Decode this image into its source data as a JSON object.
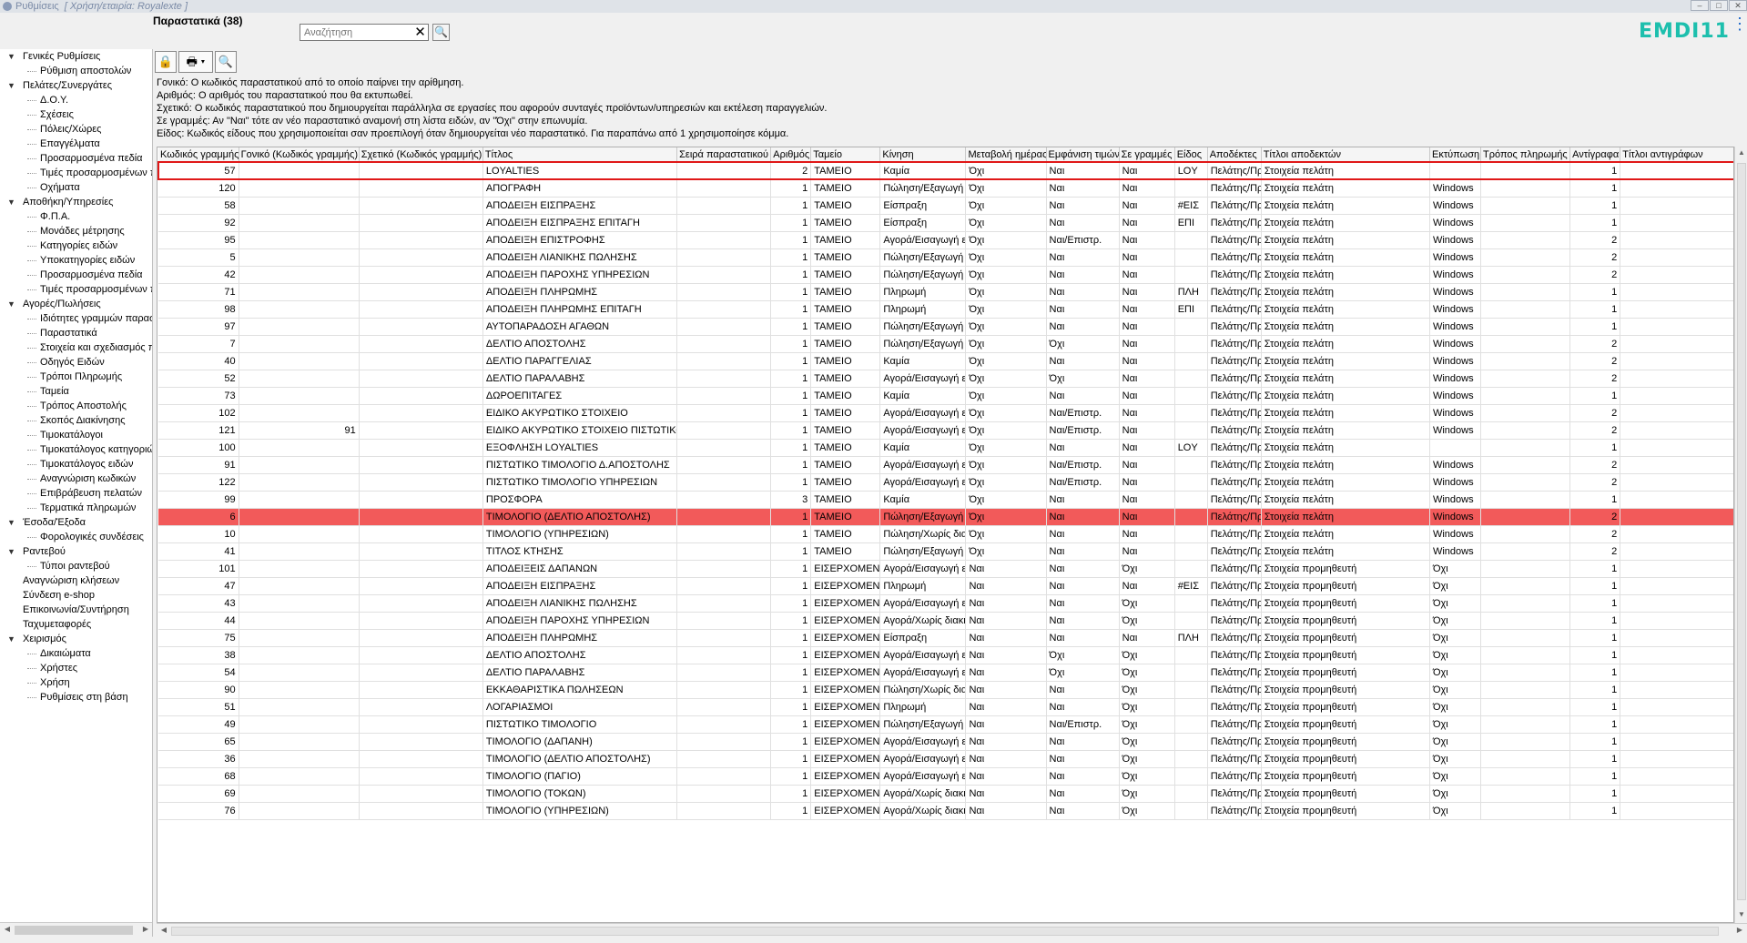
{
  "window": {
    "title": "Ρυθμίσεις",
    "company": "[ Χρήση/εταιρία: Royalexte ]",
    "controls": [
      "–",
      "□",
      "✕"
    ]
  },
  "header": {
    "section_title": "Παραστατικά (38)",
    "search_placeholder": "Αναζήτηση",
    "search_clear_icon": "✕",
    "search_button_icon": "🔍",
    "logo": "EMDI11",
    "menu_icon": "⋮"
  },
  "toolbar": {
    "lock_icon": "🔒",
    "print_icon": "🖶",
    "print_dropdown_icon": "▾",
    "search_icon": "🔍"
  },
  "tree": [
    {
      "label": "Γενικές Ρυθμίσεις",
      "level": 0,
      "toggle": "▼"
    },
    {
      "label": "Ρύθμιση αποστολών",
      "level": 1
    },
    {
      "label": "Πελάτες/Συνεργάτες",
      "level": 0,
      "toggle": "▼"
    },
    {
      "label": "Δ.Ο.Υ.",
      "level": 1
    },
    {
      "label": "Σχέσεις",
      "level": 1
    },
    {
      "label": "Πόλεις/Χώρες",
      "level": 1
    },
    {
      "label": "Επαγγέλματα",
      "level": 1
    },
    {
      "label": "Προσαρμοσμένα πεδία",
      "level": 1
    },
    {
      "label": "Τιμές προσαρμοσμένων π",
      "level": 1
    },
    {
      "label": "Οχήματα",
      "level": 1
    },
    {
      "label": "Αποθήκη/Υπηρεσίες",
      "level": 0,
      "toggle": "▼"
    },
    {
      "label": "Φ.Π.Α.",
      "level": 1
    },
    {
      "label": "Μονάδες μέτρησης",
      "level": 1
    },
    {
      "label": "Κατηγορίες ειδών",
      "level": 1
    },
    {
      "label": "Υποκατηγορίες ειδών",
      "level": 1
    },
    {
      "label": "Προσαρμοσμένα πεδία",
      "level": 1
    },
    {
      "label": "Τιμές προσαρμοσμένων π",
      "level": 1
    },
    {
      "label": "Αγορές/Πωλήσεις",
      "level": 0,
      "toggle": "▼"
    },
    {
      "label": "Ιδιότητες γραμμών παρασ",
      "level": 1
    },
    {
      "label": "Παραστατικά",
      "level": 1
    },
    {
      "label": "Στοιχεία και σχεδιασμός π",
      "level": 1
    },
    {
      "label": "Οδηγός Ειδών",
      "level": 1
    },
    {
      "label": "Τρόποι Πληρωμής",
      "level": 1
    },
    {
      "label": "Ταμεία",
      "level": 1
    },
    {
      "label": "Τρόπος Αποστολής",
      "level": 1
    },
    {
      "label": "Σκοπός Διακίνησης",
      "level": 1
    },
    {
      "label": "Τιμοκατάλογοι",
      "level": 1
    },
    {
      "label": "Τιμοκατάλογος κατηγοριώ",
      "level": 1
    },
    {
      "label": "Τιμοκατάλογος ειδών",
      "level": 1
    },
    {
      "label": "Αναγνώριση κωδικών",
      "level": 1
    },
    {
      "label": "Επιβράβευση πελατών",
      "level": 1
    },
    {
      "label": "Τερματικά πληρωμών",
      "level": 1
    },
    {
      "label": "Έσοδα/Έξοδα",
      "level": 0,
      "toggle": "▼"
    },
    {
      "label": "Φορολογικές συνδέσεις",
      "level": 1
    },
    {
      "label": "Ραντεβού",
      "level": 0,
      "toggle": "▼"
    },
    {
      "label": "Τύποι ραντεβού",
      "level": 1
    },
    {
      "label": "Αναγνώριση κλήσεων",
      "level": 0
    },
    {
      "label": "Σύνδεση e-shop",
      "level": 0
    },
    {
      "label": "Επικοινωνία/Συντήρηση",
      "level": 0
    },
    {
      "label": "Ταχυμεταφορές",
      "level": 0
    },
    {
      "label": "Χειρισμός",
      "level": 0,
      "toggle": "▼"
    },
    {
      "label": "Δικαιώματα",
      "level": 1
    },
    {
      "label": "Χρήστες",
      "level": 1
    },
    {
      "label": "Χρήση",
      "level": 1
    },
    {
      "label": "Ρυθμίσεις στη βάση",
      "level": 1
    }
  ],
  "help_lines": [
    "Γονικό: Ο κωδικός παραστατικού από το οποίο παίρνει την αρίθμηση.",
    "Αριθμός: Ο αριθμός του παραστατικού που θα εκτυπωθεί.",
    "Σχετικό: Ο κωδικός παραστατικού που δημιουργείται παράλληλα σε εργασίες που αφορούν συνταγές προϊόντων/υπηρεσιών και εκτέλεση παραγγελιών.",
    "Σε γραμμές: Αν \"Ναι\" τότε αν νέο παραστατικό αναμονή στη λίστα ειδών, αν \"Όχι\" στην επωνυμία.",
    "Είδος: Κωδικός είδους που χρησιμοποιείται σαν προεπιλογή όταν δημιουργείται νέο παραστατικό. Για παραπάνω από 1 χρησιμοποίησε κόμμα."
  ],
  "grid": {
    "columns": [
      "Κωδικός γραμμής",
      "Γονικό (Κωδικός γραμμής)",
      "Σχετικό (Κωδικός γραμμής)",
      "Τίτλος",
      "Σειρά παραστατικού",
      "Αριθμός",
      "Ταμείο",
      "Κίνηση",
      "Μεταβολή ημέρας",
      "Εμφάνιση τιμών",
      "Σε γραμμές",
      "Είδος",
      "Αποδέκτες",
      "Τίτλοι αποδεκτών",
      "Εκτύπωση",
      "Τρόπος πληρωμής",
      "Αντίγραφα",
      "Τίτλοι αντιγράφων"
    ],
    "rows": [
      [
        "57",
        "",
        "",
        "LOYALTIES",
        "",
        "2",
        "ΤΑΜΕΙΟ",
        "Καμία",
        "Όχι",
        "Ναι",
        "Ναι",
        "LOY",
        "Πελάτης/Πρ",
        "Στοιχεία πελάτη",
        "",
        "",
        "1",
        ""
      ],
      [
        "120",
        "",
        "",
        "ΑΠΟΓΡΑΦΗ",
        "",
        "1",
        "ΤΑΜΕΙΟ",
        "Πώληση/Εξαγωγή ε",
        "Όχι",
        "Ναι",
        "Ναι",
        "",
        "Πελάτης/Πρ",
        "Στοιχεία πελάτη",
        "Windows",
        "",
        "1",
        ""
      ],
      [
        "58",
        "",
        "",
        "ΑΠΟΔΕΙΞΗ ΕΙΣΠΡΑΞΗΣ",
        "",
        "1",
        "ΤΑΜΕΙΟ",
        "Είσπραξη",
        "Όχι",
        "Ναι",
        "Ναι",
        "#ΕΙΣ",
        "Πελάτης/Πρ",
        "Στοιχεία πελάτη",
        "Windows",
        "",
        "1",
        ""
      ],
      [
        "92",
        "",
        "",
        "ΑΠΟΔΕΙΞΗ ΕΙΣΠΡΑΞΗΣ ΕΠΙΤΑΓΗ",
        "",
        "1",
        "ΤΑΜΕΙΟ",
        "Είσπραξη",
        "Όχι",
        "Ναι",
        "Ναι",
        "ΕΠΙ",
        "Πελάτης/Πρ",
        "Στοιχεία πελάτη",
        "Windows",
        "",
        "1",
        ""
      ],
      [
        "95",
        "",
        "",
        "ΑΠΟΔΕΙΞΗ ΕΠΙΣΤΡΟΦΗΣ",
        "",
        "1",
        "ΤΑΜΕΙΟ",
        "Αγορά/Εισαγωγή ε",
        "Όχι",
        "Ναι/Επιστρ.",
        "Ναι",
        "",
        "Πελάτης/Πρ",
        "Στοιχεία πελάτη",
        "Windows",
        "",
        "2",
        ""
      ],
      [
        "5",
        "",
        "",
        "ΑΠΟΔΕΙΞΗ ΛΙΑΝΙΚΗΣ ΠΩΛΗΣΗΣ",
        "",
        "1",
        "ΤΑΜΕΙΟ",
        "Πώληση/Εξαγωγή ε",
        "Όχι",
        "Ναι",
        "Ναι",
        "",
        "Πελάτης/Πρ",
        "Στοιχεία πελάτη",
        "Windows",
        "",
        "2",
        ""
      ],
      [
        "42",
        "",
        "",
        "ΑΠΟΔΕΙΞΗ ΠΑΡΟΧΗΣ ΥΠΗΡΕΣΙΩΝ",
        "",
        "1",
        "ΤΑΜΕΙΟ",
        "Πώληση/Εξαγωγή ε",
        "Όχι",
        "Ναι",
        "Ναι",
        "",
        "Πελάτης/Πρ",
        "Στοιχεία πελάτη",
        "Windows",
        "",
        "2",
        ""
      ],
      [
        "71",
        "",
        "",
        "ΑΠΟΔΕΙΞΗ ΠΛΗΡΩΜΗΣ",
        "",
        "1",
        "ΤΑΜΕΙΟ",
        "Πληρωμή",
        "Όχι",
        "Ναι",
        "Ναι",
        "ΠΛΗ",
        "Πελάτης/Πρ",
        "Στοιχεία πελάτη",
        "Windows",
        "",
        "1",
        ""
      ],
      [
        "98",
        "",
        "",
        "ΑΠΟΔΕΙΞΗ ΠΛΗΡΩΜΗΣ ΕΠΙΤΑΓΗ",
        "",
        "1",
        "ΤΑΜΕΙΟ",
        "Πληρωμή",
        "Όχι",
        "Ναι",
        "Ναι",
        "ΕΠΙ",
        "Πελάτης/Πρ",
        "Στοιχεία πελάτη",
        "Windows",
        "",
        "1",
        ""
      ],
      [
        "97",
        "",
        "",
        "ΑΥΤΟΠΑΡΑΔΟΣΗ ΑΓΑΘΩΝ",
        "",
        "1",
        "ΤΑΜΕΙΟ",
        "Πώληση/Εξαγωγή ε",
        "Όχι",
        "Ναι",
        "Ναι",
        "",
        "Πελάτης/Πρ",
        "Στοιχεία πελάτη",
        "Windows",
        "",
        "1",
        ""
      ],
      [
        "7",
        "",
        "",
        "ΔΕΛΤΙΟ ΑΠΟΣΤΟΛΗΣ",
        "",
        "1",
        "ΤΑΜΕΙΟ",
        "Πώληση/Εξαγωγή ε",
        "Όχι",
        "Όχι",
        "Ναι",
        "",
        "Πελάτης/Πρ",
        "Στοιχεία πελάτη",
        "Windows",
        "",
        "2",
        ""
      ],
      [
        "40",
        "",
        "",
        "ΔΕΛΤΙΟ ΠΑΡΑΓΓΕΛΙΑΣ",
        "",
        "1",
        "ΤΑΜΕΙΟ",
        "Καμία",
        "Όχι",
        "Ναι",
        "Ναι",
        "",
        "Πελάτης/Πρ",
        "Στοιχεία πελάτη",
        "Windows",
        "",
        "2",
        ""
      ],
      [
        "52",
        "",
        "",
        "ΔΕΛΤΙΟ ΠΑΡΑΛΑΒΗΣ",
        "",
        "1",
        "ΤΑΜΕΙΟ",
        "Αγορά/Εισαγωγή ε",
        "Όχι",
        "Όχι",
        "Ναι",
        "",
        "Πελάτης/Πρ",
        "Στοιχεία πελάτη",
        "Windows",
        "",
        "2",
        ""
      ],
      [
        "73",
        "",
        "",
        "ΔΩΡΟΕΠΙΤΑΓΕΣ",
        "",
        "1",
        "ΤΑΜΕΙΟ",
        "Καμία",
        "Όχι",
        "Ναι",
        "Ναι",
        "",
        "Πελάτης/Πρ",
        "Στοιχεία πελάτη",
        "Windows",
        "",
        "1",
        ""
      ],
      [
        "102",
        "",
        "",
        "ΕΙΔΙΚΟ ΑΚΥΡΩΤΙΚΟ ΣΤΟΙΧΕΙΟ",
        "",
        "1",
        "ΤΑΜΕΙΟ",
        "Αγορά/Εισαγωγή ε",
        "Όχι",
        "Ναι/Επιστρ.",
        "Ναι",
        "",
        "Πελάτης/Πρ",
        "Στοιχεία πελάτη",
        "Windows",
        "",
        "2",
        ""
      ],
      [
        "121",
        "91",
        "",
        "ΕΙΔΙΚΟ ΑΚΥΡΩΤΙΚΟ ΣΤΟΙΧΕΙΟ ΠΙΣΤΩΤΙΚΟ",
        "",
        "1",
        "ΤΑΜΕΙΟ",
        "Αγορά/Εισαγωγή ε",
        "Όχι",
        "Ναι/Επιστρ.",
        "Ναι",
        "",
        "Πελάτης/Πρ",
        "Στοιχεία πελάτη",
        "Windows",
        "",
        "2",
        ""
      ],
      [
        "100",
        "",
        "",
        "ΕΞΟΦΛΗΣΗ LOYALTIES",
        "",
        "1",
        "ΤΑΜΕΙΟ",
        "Καμία",
        "Όχι",
        "Ναι",
        "Ναι",
        "LOY",
        "Πελάτης/Πρ",
        "Στοιχεία πελάτη",
        "",
        "",
        "1",
        ""
      ],
      [
        "91",
        "",
        "",
        "ΠΙΣΤΩΤΙΚΟ ΤΙΜΟΛΟΓΙΟ Δ.ΑΠΟΣΤΟΛΗΣ",
        "",
        "1",
        "ΤΑΜΕΙΟ",
        "Αγορά/Εισαγωγή ε",
        "Όχι",
        "Ναι/Επιστρ.",
        "Ναι",
        "",
        "Πελάτης/Πρ",
        "Στοιχεία πελάτη",
        "Windows",
        "",
        "2",
        ""
      ],
      [
        "122",
        "",
        "",
        "ΠΙΣΤΩΤΙΚΟ ΤΙΜΟΛΟΓΙΟ ΥΠΗΡΕΣΙΩΝ",
        "",
        "1",
        "ΤΑΜΕΙΟ",
        "Αγορά/Εισαγωγή ε",
        "Όχι",
        "Ναι/Επιστρ.",
        "Ναι",
        "",
        "Πελάτης/Πρ",
        "Στοιχεία πελάτη",
        "Windows",
        "",
        "2",
        ""
      ],
      [
        "99",
        "",
        "",
        "ΠΡΟΣΦΟΡΑ",
        "",
        "3",
        "ΤΑΜΕΙΟ",
        "Καμία",
        "Όχι",
        "Ναι",
        "Ναι",
        "",
        "Πελάτης/Πρ",
        "Στοιχεία πελάτη",
        "Windows",
        "",
        "1",
        ""
      ],
      [
        "6",
        "",
        "",
        "ΤΙΜΟΛΟΓΙΟ (ΔΕΛΤΙΟ ΑΠΟΣΤΟΛΗΣ)",
        "",
        "1",
        "ΤΑΜΕΙΟ",
        "Πώληση/Εξαγωγή ε",
        "Όχι",
        "Ναι",
        "Ναι",
        "",
        "Πελάτης/Πρ",
        "Στοιχεία πελάτη",
        "Windows",
        "",
        "2",
        ""
      ],
      [
        "10",
        "",
        "",
        "ΤΙΜΟΛΟΓΙΟ (ΥΠΗΡΕΣΙΩΝ)",
        "",
        "1",
        "ΤΑΜΕΙΟ",
        "Πώληση/Χωρίς διακ",
        "Όχι",
        "Ναι",
        "Ναι",
        "",
        "Πελάτης/Πρ",
        "Στοιχεία πελάτη",
        "Windows",
        "",
        "2",
        ""
      ],
      [
        "41",
        "",
        "",
        "ΤΙΤΛΟΣ ΚΤΗΣΗΣ",
        "",
        "1",
        "ΤΑΜΕΙΟ",
        "Πώληση/Εξαγωγή ε",
        "Όχι",
        "Ναι",
        "Ναι",
        "",
        "Πελάτης/Πρ",
        "Στοιχεία πελάτη",
        "Windows",
        "",
        "2",
        ""
      ],
      [
        "101",
        "",
        "",
        "ΑΠΟΔΕΙΞΕΙΣ ΔΑΠΑΝΩΝ",
        "",
        "1",
        "ΕΙΣΕΡΧΟΜΕΝΑ",
        "Αγορά/Εισαγωγή ε",
        "Ναι",
        "Ναι",
        "Όχι",
        "",
        "Πελάτης/Πρ",
        "Στοιχεία προμηθευτή",
        "Όχι",
        "",
        "1",
        ""
      ],
      [
        "47",
        "",
        "",
        "ΑΠΟΔΕΙΞΗ ΕΙΣΠΡΑΞΗΣ",
        "",
        "1",
        "ΕΙΣΕΡΧΟΜΕΝΑ",
        "Πληρωμή",
        "Ναι",
        "Ναι",
        "Ναι",
        "#ΕΙΣ",
        "Πελάτης/Πρ",
        "Στοιχεία προμηθευτή",
        "Όχι",
        "",
        "1",
        ""
      ],
      [
        "43",
        "",
        "",
        "ΑΠΟΔΕΙΞΗ ΛΙΑΝΙΚΗΣ ΠΩΛΗΣΗΣ",
        "",
        "1",
        "ΕΙΣΕΡΧΟΜΕΝΑ",
        "Αγορά/Εισαγωγή ε",
        "Ναι",
        "Ναι",
        "Όχι",
        "",
        "Πελάτης/Πρ",
        "Στοιχεία προμηθευτή",
        "Όχι",
        "",
        "1",
        ""
      ],
      [
        "44",
        "",
        "",
        "ΑΠΟΔΕΙΞΗ ΠΑΡΟΧΗΣ ΥΠΗΡΕΣΙΩΝ",
        "",
        "1",
        "ΕΙΣΕΡΧΟΜΕΝΑ",
        "Αγορά/Χωρίς διακι",
        "Ναι",
        "Ναι",
        "Όχι",
        "",
        "Πελάτης/Πρ",
        "Στοιχεία προμηθευτή",
        "Όχι",
        "",
        "1",
        ""
      ],
      [
        "75",
        "",
        "",
        "ΑΠΟΔΕΙΞΗ ΠΛΗΡΩΜΗΣ",
        "",
        "1",
        "ΕΙΣΕΡΧΟΜΕΝΑ",
        "Είσπραξη",
        "Ναι",
        "Ναι",
        "Ναι",
        "ΠΛΗ",
        "Πελάτης/Πρ",
        "Στοιχεία προμηθευτή",
        "Όχι",
        "",
        "1",
        ""
      ],
      [
        "38",
        "",
        "",
        "ΔΕΛΤΙΟ ΑΠΟΣΤΟΛΗΣ",
        "",
        "1",
        "ΕΙΣΕΡΧΟΜΕΝΑ",
        "Αγορά/Εισαγωγή ε",
        "Ναι",
        "Όχι",
        "Όχι",
        "",
        "Πελάτης/Πρ",
        "Στοιχεία προμηθευτή",
        "Όχι",
        "",
        "1",
        ""
      ],
      [
        "54",
        "",
        "",
        "ΔΕΛΤΙΟ ΠΑΡΑΛΑΒΗΣ",
        "",
        "1",
        "ΕΙΣΕΡΧΟΜΕΝΑ",
        "Αγορά/Εισαγωγή ε",
        "Ναι",
        "Όχι",
        "Όχι",
        "",
        "Πελάτης/Πρ",
        "Στοιχεία προμηθευτή",
        "Όχι",
        "",
        "1",
        ""
      ],
      [
        "90",
        "",
        "",
        "ΕΚΚΑΘΑΡΙΣΤΙΚΑ ΠΩΛΗΣΕΩΝ",
        "",
        "1",
        "ΕΙΣΕΡΧΟΜΕΝΑ",
        "Πώληση/Χωρίς διακ",
        "Ναι",
        "Ναι",
        "Όχι",
        "",
        "Πελάτης/Πρ",
        "Στοιχεία προμηθευτή",
        "Όχι",
        "",
        "1",
        ""
      ],
      [
        "51",
        "",
        "",
        "ΛΟΓΑΡΙΑΣΜΟΙ",
        "",
        "1",
        "ΕΙΣΕΡΧΟΜΕΝΑ",
        "Πληρωμή",
        "Ναι",
        "Ναι",
        "Όχι",
        "",
        "Πελάτης/Πρ",
        "Στοιχεία προμηθευτή",
        "Όχι",
        "",
        "1",
        ""
      ],
      [
        "49",
        "",
        "",
        "ΠΙΣΤΩΤΙΚΟ ΤΙΜΟΛΟΓΙΟ",
        "",
        "1",
        "ΕΙΣΕΡΧΟΜΕΝΑ",
        "Πώληση/Εξαγωγή ε",
        "Ναι",
        "Ναι/Επιστρ.",
        "Όχι",
        "",
        "Πελάτης/Πρ",
        "Στοιχεία προμηθευτή",
        "Όχι",
        "",
        "1",
        ""
      ],
      [
        "65",
        "",
        "",
        "ΤΙΜΟΛΟΓΙΟ (ΔΑΠΑΝΗ)",
        "",
        "1",
        "ΕΙΣΕΡΧΟΜΕΝΑ",
        "Αγορά/Εισαγωγή ε",
        "Ναι",
        "Ναι",
        "Όχι",
        "",
        "Πελάτης/Πρ",
        "Στοιχεία προμηθευτή",
        "Όχι",
        "",
        "1",
        ""
      ],
      [
        "36",
        "",
        "",
        "ΤΙΜΟΛΟΓΙΟ (ΔΕΛΤΙΟ ΑΠΟΣΤΟΛΗΣ)",
        "",
        "1",
        "ΕΙΣΕΡΧΟΜΕΝΑ",
        "Αγορά/Εισαγωγή ε",
        "Ναι",
        "Ναι",
        "Όχι",
        "",
        "Πελάτης/Πρ",
        "Στοιχεία προμηθευτή",
        "Όχι",
        "",
        "1",
        ""
      ],
      [
        "68",
        "",
        "",
        "ΤΙΜΟΛΟΓΙΟ (ΠΑΓΙΟ)",
        "",
        "1",
        "ΕΙΣΕΡΧΟΜΕΝΑ",
        "Αγορά/Εισαγωγή ε",
        "Ναι",
        "Ναι",
        "Όχι",
        "",
        "Πελάτης/Πρ",
        "Στοιχεία προμηθευτή",
        "Όχι",
        "",
        "1",
        ""
      ],
      [
        "69",
        "",
        "",
        "ΤΙΜΟΛΟΓΙΟ (ΤΟΚΩΝ)",
        "",
        "1",
        "ΕΙΣΕΡΧΟΜΕΝΑ",
        "Αγορά/Χωρίς διακι",
        "Ναι",
        "Ναι",
        "Όχι",
        "",
        "Πελάτης/Πρ",
        "Στοιχεία προμηθευτή",
        "Όχι",
        "",
        "1",
        ""
      ],
      [
        "76",
        "",
        "",
        "ΤΙΜΟΛΟΓΙΟ (ΥΠΗΡΕΣΙΩΝ)",
        "",
        "1",
        "ΕΙΣΕΡΧΟΜΕΝΑ",
        "Αγορά/Χωρίς διακι",
        "Ναι",
        "Ναι",
        "Όχι",
        "",
        "Πελάτης/Πρ",
        "Στοιχεία προμηθευτή",
        "Όχι",
        "",
        "1",
        ""
      ]
    ],
    "selected_row": 20,
    "outlined_row": 0
  },
  "colors": {
    "selected_row": "#f25a5a",
    "outline": "#e01818",
    "logo": "#1dbfad",
    "menu": "#1b66c9"
  }
}
